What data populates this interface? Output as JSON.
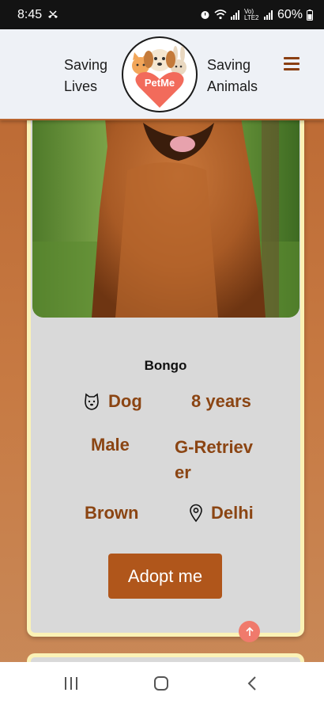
{
  "status_bar": {
    "time": "8:45",
    "battery": "60%",
    "icons": [
      "missed-call-icon",
      "alarm-icon",
      "wifi-icon",
      "signal-icon",
      "volte-icon",
      "signal-icon",
      "battery-icon"
    ],
    "volte_label": "Vo) LTE2"
  },
  "header": {
    "tagline_left": "Saving Lives",
    "tagline_right": "Saving Animals",
    "logo_text": "PetMe",
    "menu_icon": "hamburger-menu-icon"
  },
  "pet": {
    "name": "Bongo",
    "species": "Dog",
    "age": "8 years",
    "gender": "Male",
    "breed": "G-Retriever",
    "color": "Brown",
    "location": "Delhi",
    "adopt_label": "Adopt me"
  },
  "colors": {
    "accent": "#b0561b",
    "info_text": "#8b4513",
    "card_border": "#fbf2b6",
    "background": "#b9652f",
    "scroll_top": "#f07a6c"
  },
  "nav": {
    "buttons": [
      "recent-apps-icon",
      "home-icon",
      "back-icon"
    ]
  }
}
